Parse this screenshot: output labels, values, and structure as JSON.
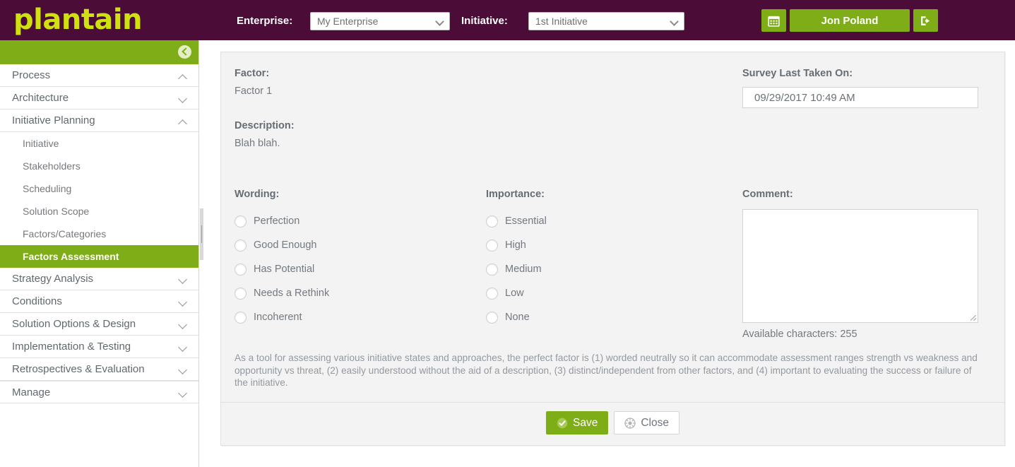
{
  "brand": {
    "name": "plantain"
  },
  "topbar": {
    "enterprise_label": "Enterprise:",
    "enterprise_value": "My Enterprise",
    "initiative_label": "Initiative:",
    "initiative_value": "1st Initiative",
    "calendar_icon": "calendar-icon",
    "user_name": "Jon Poland",
    "logout_icon": "logout-icon",
    "accent_green": "#7fad17",
    "header_purple": "#4b0c37",
    "brand_yellow": "#cfe20e"
  },
  "sidebar": {
    "collapse_icon": "chevron-left-icon",
    "groups": [
      {
        "label": "Process",
        "expanded": true,
        "items": []
      },
      {
        "label": "Architecture",
        "expanded": false,
        "items": []
      },
      {
        "label": "Initiative Planning",
        "expanded": true,
        "items": [
          {
            "label": "Initiative",
            "active": false
          },
          {
            "label": "Stakeholders",
            "active": false
          },
          {
            "label": "Scheduling",
            "active": false
          },
          {
            "label": "Solution Scope",
            "active": false
          },
          {
            "label": "Factors/Categories",
            "active": false
          },
          {
            "label": "Factors Assessment",
            "active": true
          }
        ]
      },
      {
        "label": "Strategy Analysis",
        "expanded": false,
        "items": []
      },
      {
        "label": "Conditions",
        "expanded": false,
        "items": []
      },
      {
        "label": "Solution Options & Design",
        "expanded": false,
        "items": []
      },
      {
        "label": "Implementation & Testing",
        "expanded": false,
        "items": []
      },
      {
        "label": "Retrospectives & Evaluation",
        "expanded": false,
        "items": []
      },
      {
        "label": "Manage",
        "expanded": false,
        "items": []
      }
    ]
  },
  "form": {
    "factor_label": "Factor:",
    "factor_value": "Factor 1",
    "description_label": "Description:",
    "description_value": "Blah blah.",
    "survey_label": "Survey Last Taken On:",
    "survey_value": "09/29/2017 10:49 AM",
    "wording_label": "Wording:",
    "wording_options": [
      {
        "label": "Perfection",
        "selected": false
      },
      {
        "label": "Good Enough",
        "selected": false
      },
      {
        "label": "Has Potential",
        "selected": false
      },
      {
        "label": "Needs a Rethink",
        "selected": false
      },
      {
        "label": "Incoherent",
        "selected": false
      }
    ],
    "importance_label": "Importance:",
    "importance_options": [
      {
        "label": "Essential",
        "selected": false
      },
      {
        "label": "High",
        "selected": false
      },
      {
        "label": "Medium",
        "selected": false
      },
      {
        "label": "Low",
        "selected": false
      },
      {
        "label": "None",
        "selected": false
      }
    ],
    "comment_label": "Comment:",
    "comment_value": "",
    "comment_placeholder": "",
    "available_characters": "Available characters: 255",
    "help_text": "As a tool for assessing various initiative states and approaches, the perfect factor is (1) worded neutrally so it can accommodate assessment ranges strength vs weakness and opportunity vs threat, (2) easily understood without the aid of a description, (3) distinct/independent from other factors, and (4) important to evaluating the success or failure of the initiative.",
    "save_label": "Save",
    "save_icon": "check-circle-icon",
    "close_label": "Close",
    "close_icon": "cancel-circle-icon"
  }
}
